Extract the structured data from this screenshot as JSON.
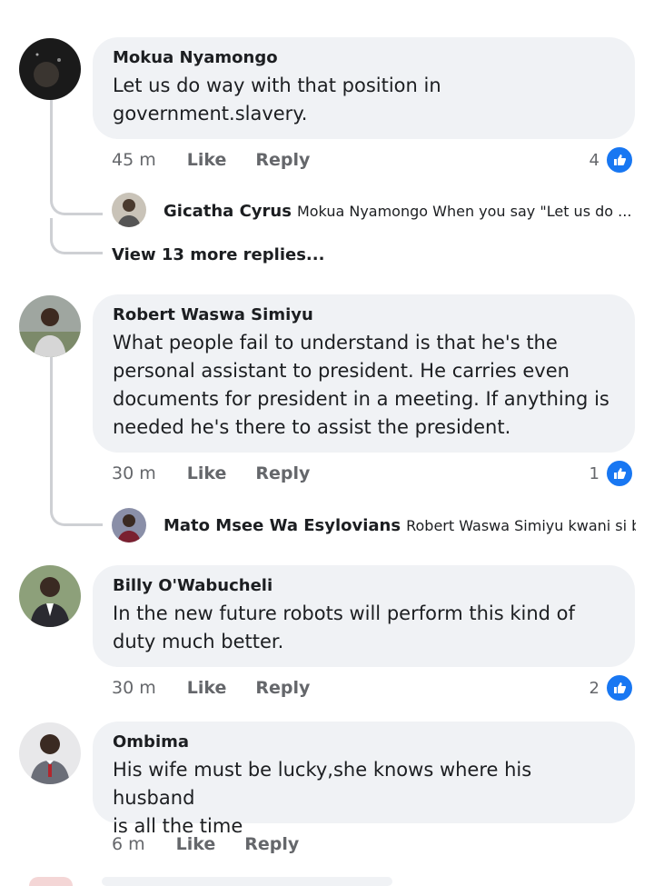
{
  "comments": [
    {
      "author": "Mokua Nyamongo",
      "text_line1": "Let us do way with that position in",
      "text_line2": "government.slavery.",
      "time": "45 m",
      "like": "Like",
      "reply": "Reply",
      "reaction_count": "4",
      "reply_preview": {
        "author": "Gicatha Cyrus",
        "text": "Mokua Nyamongo When you say \"Let us do ..."
      },
      "view_more": "View 13 more replies..."
    },
    {
      "author": "Robert Waswa Simiyu",
      "text_line1": "What people fail to understand is that he's the",
      "text_line2": "personal assistant to president. He carries even",
      "text_line3": "documents for president in a meeting. If anything is",
      "text_line4": "needed he's there to assist the president.",
      "time": "30 m",
      "like": "Like",
      "reply": "Reply",
      "reaction_count": "1",
      "reply_preview": {
        "author": "Mato Msee Wa Esylovians",
        "text": "Robert Waswa Simiyu kwani si b..."
      }
    },
    {
      "author": "Billy O'Wabucheli",
      "text_line1": "In the new future robots will perform this kind of",
      "text_line2": "duty much better.",
      "time": "30 m",
      "like": "Like",
      "reply": "Reply",
      "reaction_count": "2"
    },
    {
      "author": "Ombima",
      "text_line1": "His wife must be lucky,she knows where his husband",
      "text_line2": "is all the time",
      "time": "6 m",
      "like": "Like",
      "reply": "Reply"
    }
  ],
  "colors": {
    "bubble": "#f0f2f5",
    "like_blue": "#1877f2",
    "muted": "#65676b"
  }
}
